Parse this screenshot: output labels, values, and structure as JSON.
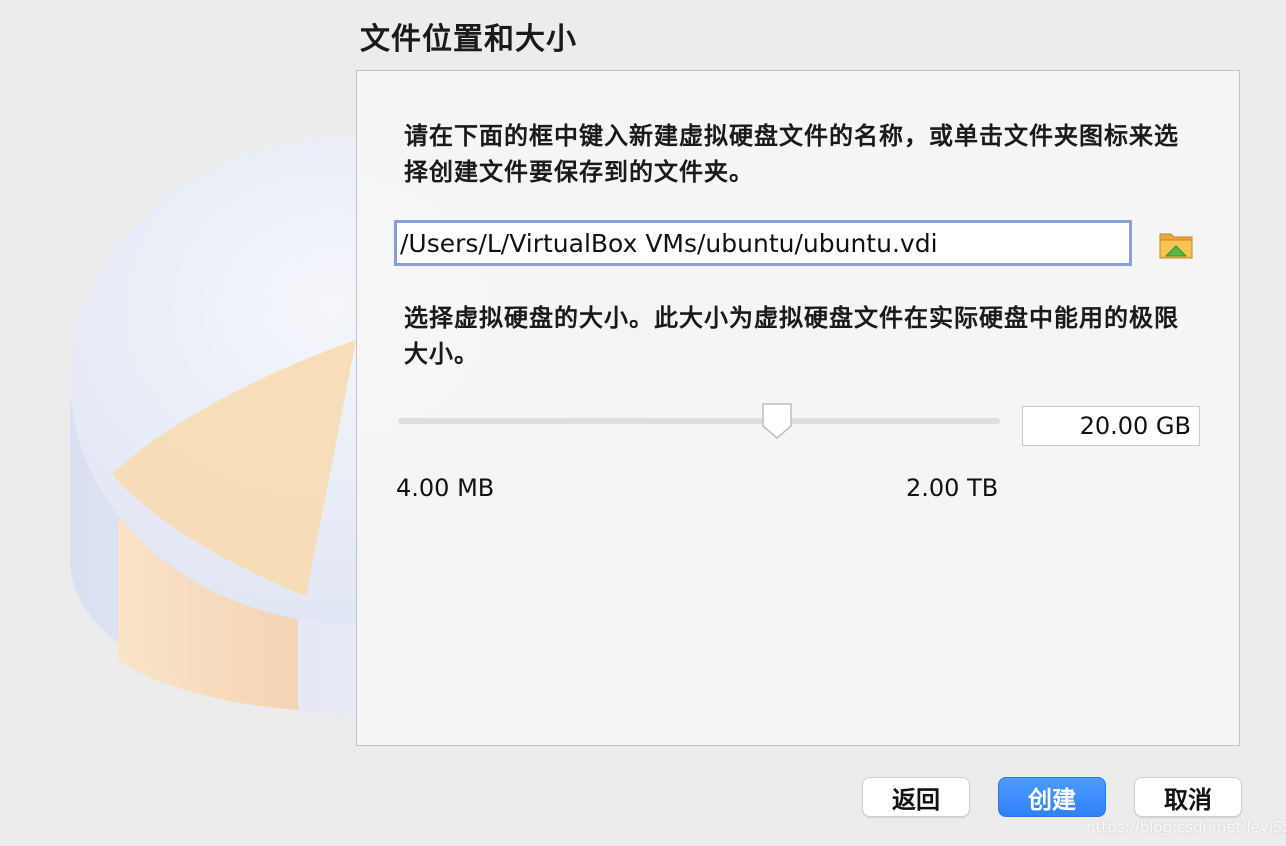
{
  "dialog": {
    "title": "文件位置和大小",
    "location_description": "请在下面的框中键入新建虚拟硬盘文件的名称，或单击文件夹图标来选择创建文件要保存到的文件夹。",
    "file_path": "/Users/L/VirtualBox VMs/ubuntu/ubuntu.vdi",
    "folder_icon": "folder-icon",
    "size_description": "选择虚拟硬盘的大小。此大小为虚拟硬盘文件在实际硬盘中能用的极限大小。",
    "size_value": "20.00 GB",
    "size_slider_fraction": 0.63,
    "size_min": "4.00 MB",
    "size_max": "2.00 TB"
  },
  "buttons": {
    "back": "返回",
    "create": "创建",
    "cancel": "取消"
  },
  "watermark": "https://blog.csdn.net/leyi520",
  "colors": {
    "primary_button": "#2f82f5",
    "input_focus_border": "#8aa0d8",
    "window_background": "#ececec"
  }
}
